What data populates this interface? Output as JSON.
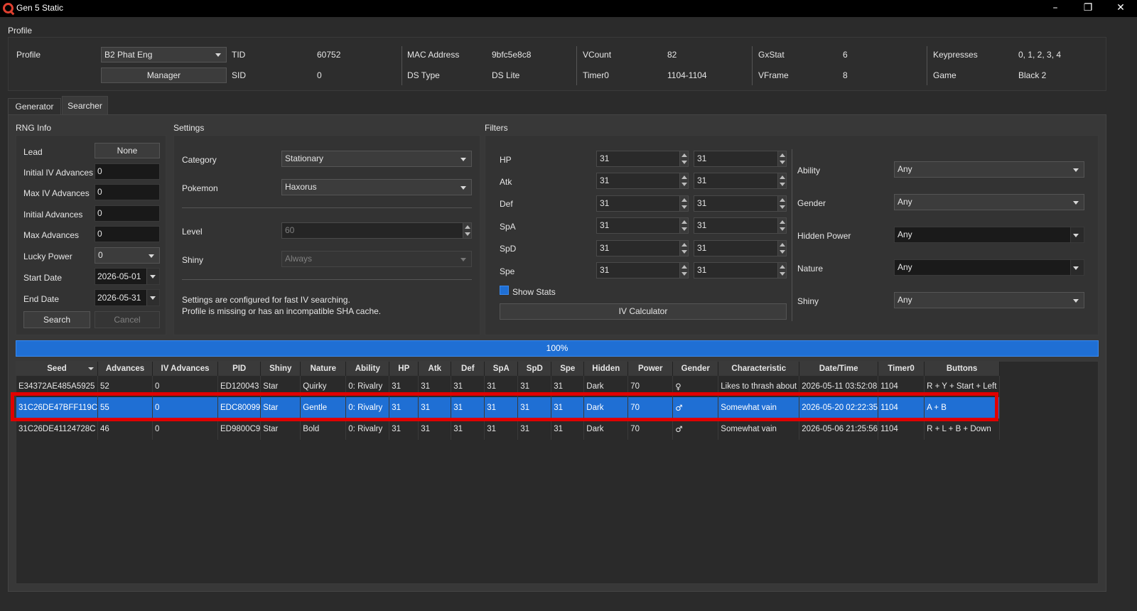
{
  "window": {
    "title": "Gen 5 Static",
    "min": "–",
    "restore": "❐",
    "close": "✕"
  },
  "profile_group": {
    "label": "Profile",
    "profile_label": "Profile",
    "profile_value": "B2 Phat Eng",
    "manager_label": "Manager",
    "fields": {
      "tid_label": "TID",
      "tid": "60752",
      "sid_label": "SID",
      "sid": "0",
      "mac_label": "MAC Address",
      "mac": "9bfc5e8c8",
      "dstype_label": "DS Type",
      "dstype": "DS Lite",
      "vcount_label": "VCount",
      "vcount": "82",
      "timer0_label": "Timer0",
      "timer0": "1104-1104",
      "gxstat_label": "GxStat",
      "gxstat": "6",
      "vframe_label": "VFrame",
      "vframe": "8",
      "keys_label": "Keypresses",
      "keys": "0, 1, 2, 3, 4",
      "game_label": "Game",
      "game": "Black 2"
    }
  },
  "tabs": [
    {
      "label": "Generator"
    },
    {
      "label": "Searcher"
    }
  ],
  "rng_info": {
    "label": "RNG Info",
    "lead_label": "Lead",
    "lead_value": "None",
    "init_iv_label": "Initial IV Advances",
    "init_iv": "0",
    "max_iv_label": "Max IV Advances",
    "max_iv": "0",
    "init_adv_label": "Initial Advances",
    "init_adv": "0",
    "max_adv_label": "Max Advances",
    "max_adv": "0",
    "lucky_label": "Lucky Power",
    "lucky": "0",
    "start_label": "Start Date",
    "start": "2026-05-01",
    "end_label": "End Date",
    "end": "2026-05-31",
    "search_label": "Search",
    "cancel_label": "Cancel"
  },
  "settings": {
    "label": "Settings",
    "category_label": "Category",
    "category": "Stationary",
    "pokemon_label": "Pokemon",
    "pokemon": "Haxorus",
    "level_label": "Level",
    "level": "60",
    "shiny_label": "Shiny",
    "shiny": "Always",
    "note1": "Settings are configured for fast IV searching.",
    "note2": "Profile is missing or has an incompatible SHA cache."
  },
  "filters": {
    "label": "Filters",
    "ivs": [
      {
        "stat": "HP",
        "min": "31",
        "max": "31"
      },
      {
        "stat": "Atk",
        "min": "31",
        "max": "31"
      },
      {
        "stat": "Def",
        "min": "31",
        "max": "31"
      },
      {
        "stat": "SpA",
        "min": "31",
        "max": "31"
      },
      {
        "stat": "SpD",
        "min": "31",
        "max": "31"
      },
      {
        "stat": "Spe",
        "min": "31",
        "max": "31"
      }
    ],
    "show_stats": "Show Stats",
    "iv_calc": "IV Calculator",
    "ability_label": "Ability",
    "ability": "Any",
    "gender_label": "Gender",
    "gender": "Any",
    "hp_label": "Hidden Power",
    "hp": "Any",
    "nature_label": "Nature",
    "nature": "Any",
    "shiny_label": "Shiny",
    "shiny": "Any"
  },
  "progress": {
    "text": "100%",
    "value": 1.0
  },
  "table": {
    "columns": [
      "Seed",
      "Advances",
      "IV Advances",
      "PID",
      "Shiny",
      "Nature",
      "Ability",
      "HP",
      "Atk",
      "Def",
      "SpA",
      "SpD",
      "Spe",
      "Hidden",
      "Power",
      "Gender",
      "Characteristic",
      "Date/Time",
      "Timer0",
      "Buttons"
    ],
    "rows": [
      [
        "E34372AE485A5925",
        "52",
        "0",
        "ED120043",
        "Star",
        "Quirky",
        "0: Rivalry",
        "31",
        "31",
        "31",
        "31",
        "31",
        "31",
        "Dark",
        "70",
        "♀",
        "Likes to thrash about",
        "2026-05-11 03:52:08",
        "1104",
        "R + Y + Start + Left"
      ],
      [
        "31C26DE47BFF119C",
        "55",
        "0",
        "EDC80099",
        "Star",
        "Gentle",
        "0: Rivalry",
        "31",
        "31",
        "31",
        "31",
        "31",
        "31",
        "Dark",
        "70",
        "♂",
        "Somewhat vain",
        "2026-05-20 02:22:35",
        "1104",
        "A + B"
      ],
      [
        "31C26DE41124728C",
        "46",
        "0",
        "ED9800C9",
        "Star",
        "Bold",
        "0: Rivalry",
        "31",
        "31",
        "31",
        "31",
        "31",
        "31",
        "Dark",
        "70",
        "♂",
        "Somewhat vain",
        "2026-05-06 21:25:56",
        "1104",
        "R + L + B + Down"
      ]
    ]
  },
  "colors": {
    "accent": "#1f6fd4",
    "highlight": "#e00000",
    "bg": "#2b2b2b"
  }
}
